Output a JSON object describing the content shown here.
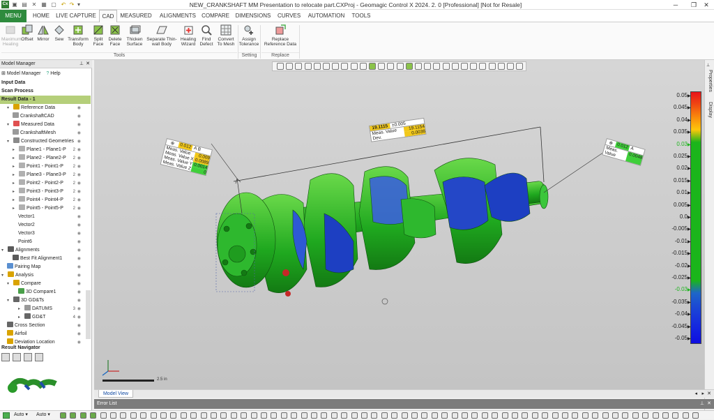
{
  "app": {
    "title": "NEW_CRANKSHAFT MM Presentation to relocate part.CXProj - Geomagic Control X 2024. 2. 0 [Professional] [Not for Resale]",
    "logo_text": "Cx"
  },
  "menubar": {
    "tabs": [
      "MENU",
      "HOME",
      "LIVE CAPTURE",
      "CAD",
      "MEASURED",
      "ALIGNMENTS",
      "COMPARE",
      "DIMENSIONS",
      "CURVES",
      "AUTOMATION",
      "TOOLS"
    ],
    "active_tab": "CAD"
  },
  "ribbon": {
    "tools": [
      "Maximum Healing",
      "Offset",
      "Mirror",
      "Sew",
      "Transform Body",
      "Split Face",
      "Delete Face",
      "Thicken Surface",
      "Separate Thin-wall Body",
      "Healing Wizard",
      "Find Defect",
      "Convert To Mesh"
    ],
    "setting": [
      "Assign Tolerance"
    ],
    "replace": [
      "Replace Reference Data"
    ],
    "groups": {
      "tools": "Tools",
      "setting": "Setting",
      "replace": "Replace"
    }
  },
  "model_manager": {
    "title": "Model Manager",
    "model_manager_btn": "Model Manager",
    "help_btn": "Help",
    "tree": [
      {
        "label": "Input Data",
        "bold": true
      },
      {
        "label": "Scan Process",
        "bold": true
      },
      {
        "label": "Result Data - 1",
        "bold": true,
        "selected": true
      },
      {
        "label": "Reference Data",
        "indent": 1,
        "expander": "v",
        "icon": "#d9a300"
      },
      {
        "label": "CrankshaftCAD",
        "indent": 2,
        "icon": "#9a9a9a"
      },
      {
        "label": "Measured Data",
        "indent": 1,
        "expander": "v",
        "icon": "#e05050"
      },
      {
        "label": "CrankshaftMesh",
        "indent": 2,
        "icon": "#9a9a9a"
      },
      {
        "label": "Constructed Geometries",
        "indent": 1,
        "expander": "v",
        "icon": "#8a8a8a"
      },
      {
        "label": "Plane1 - Plane1-P",
        "indent": 2,
        "expander": ">",
        "icon": "#b0b0b0",
        "num": "2"
      },
      {
        "label": "Plane2 - Plane2-P",
        "indent": 2,
        "expander": ">",
        "icon": "#b0b0b0",
        "num": "2"
      },
      {
        "label": "Point1 - Point1-P",
        "indent": 2,
        "expander": ">",
        "icon": "#b0b0b0",
        "num": "2"
      },
      {
        "label": "Plane3 - Plane3-P",
        "indent": 2,
        "expander": ">",
        "icon": "#b0b0b0",
        "num": "2"
      },
      {
        "label": "Point2 - Point2-P",
        "indent": 2,
        "expander": ">",
        "icon": "#b0b0b0",
        "num": "2"
      },
      {
        "label": "Point3 - Point3-P",
        "indent": 2,
        "expander": ">",
        "icon": "#b0b0b0",
        "num": "2"
      },
      {
        "label": "Point4 - Point4-P",
        "indent": 2,
        "expander": ">",
        "icon": "#b0b0b0",
        "num": "2"
      },
      {
        "label": "Point5 - Point5-P",
        "indent": 2,
        "expander": ">",
        "icon": "#b0b0b0",
        "num": "2"
      },
      {
        "label": "Vector1",
        "indent": 3
      },
      {
        "label": "Vector2",
        "indent": 3
      },
      {
        "label": "Vector3",
        "indent": 3
      },
      {
        "label": "Point6",
        "indent": 3
      },
      {
        "label": "Alignments",
        "indent": 0,
        "expander": "v",
        "icon": "#5a5a5a"
      },
      {
        "label": "Best Fit Alignment1",
        "indent": 2,
        "icon": "#5a5a5a"
      },
      {
        "label": "Pairing Map",
        "indent": 1,
        "icon": "#5a8fd0"
      },
      {
        "label": "Analysis",
        "indent": 0,
        "expander": "v",
        "icon": "#d9a300"
      },
      {
        "label": "Compare",
        "indent": 1,
        "expander": "v",
        "icon": "#d9a300"
      },
      {
        "label": "3D Compare1",
        "indent": 3,
        "icon": "#4aa04a"
      },
      {
        "label": "3D GD&Ts",
        "indent": 1,
        "expander": "v",
        "icon": "#666"
      },
      {
        "label": "DATUMS",
        "indent": 3,
        "expander": ">",
        "icon": "#999",
        "num": "3"
      },
      {
        "label": "GD&T",
        "indent": 3,
        "expander": ">",
        "icon": "#666",
        "num": "4"
      },
      {
        "label": "Cross Section",
        "indent": 1,
        "icon": "#666"
      },
      {
        "label": "Airfoil",
        "indent": 1,
        "icon": "#d9a300"
      },
      {
        "label": "Deviation Location",
        "indent": 1,
        "icon": "#d9a300"
      }
    ]
  },
  "result_navigator": {
    "title": "Result Navigator"
  },
  "viewport": {
    "tab_label": "Model View",
    "scale_bar_label": "2.5 in",
    "annotation_left": {
      "value": "0.012",
      "ref": "A B",
      "rows": [
        {
          "label": "Meas. Value",
          "value": "0.009"
        },
        {
          "label": "Meas. Value X",
          "value": "0.0089"
        },
        {
          "label": "Meas. Value Y",
          "value": "0.0014"
        },
        {
          "label": "Meas. Value Z",
          "value": "0"
        }
      ]
    },
    "annotation_mid": {
      "nominal": "19.1115",
      "tol": "±0.005",
      "rows": [
        {
          "label": "Meas. Value",
          "value": "19.1154"
        },
        {
          "label": "Dev.",
          "value": "0.0038"
        }
      ]
    },
    "annotation_right": {
      "value": "0.012",
      "ref": "A",
      "rows": [
        {
          "label": "Meas. Value",
          "value": "0.0048"
        }
      ]
    }
  },
  "color_scale": {
    "labels": [
      "0.05",
      "0.045",
      "0.04",
      "0.035",
      "0.03",
      "0.025",
      "0.02",
      "0.015",
      "0.01",
      "0.005",
      "0.0",
      "-0.005",
      "-0.01",
      "-0.015",
      "-0.02",
      "-0.025",
      "-0.03",
      "-0.035",
      "-0.04",
      "-0.045",
      "-0.05"
    ],
    "highlight": [
      "0.03",
      "-0.03"
    ],
    "colors": [
      "#e8141b",
      "#f04a12",
      "#f98a0c",
      "#fdc70b",
      "#1bb51b",
      "#1bb51b",
      "#1bb51b",
      "#1bb51b",
      "#1bb51b",
      "#1bb51b",
      "#1bb51b",
      "#1bb51b",
      "#1bb51b",
      "#1bb51b",
      "#1bb51b",
      "#1bb51b",
      "#1f66c8",
      "#1c4bd3",
      "#1835db",
      "#1321e0",
      "#0f0fe0"
    ]
  },
  "right_strip": {
    "properties": "Properties",
    "display": "Display"
  },
  "error_list": {
    "title": "Error List"
  },
  "status": {
    "auto1": "Auto",
    "auto2": "Auto"
  }
}
